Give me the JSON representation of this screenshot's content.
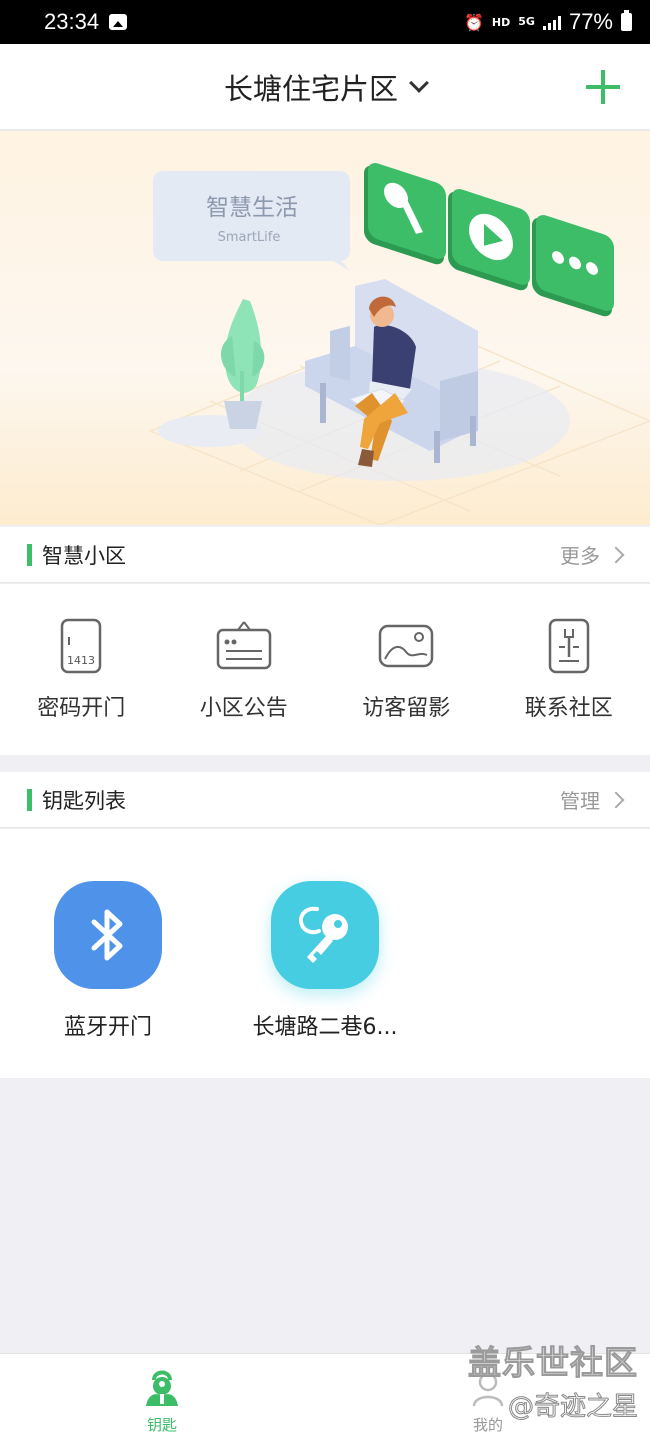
{
  "status_bar": {
    "time": "23:34",
    "network": "HD",
    "network_type": "5G",
    "battery": "77%"
  },
  "header": {
    "title": "长塘住宅片区"
  },
  "banner": {
    "bubble_title": "智慧生活",
    "bubble_subtitle": "SmartLife"
  },
  "smart_section": {
    "title": "智慧小区",
    "more_label": "更多",
    "items": [
      {
        "label": "密码开门",
        "icon": "keypad-icon",
        "icon_text": "1413"
      },
      {
        "label": "小区公告",
        "icon": "notice-board-icon"
      },
      {
        "label": "访客留影",
        "icon": "photo-icon"
      },
      {
        "label": "联系社区",
        "icon": "wrench-document-icon"
      }
    ]
  },
  "keys_section": {
    "title": "钥匙列表",
    "manage_label": "管理",
    "items": [
      {
        "label": "蓝牙开门",
        "icon": "bluetooth-icon",
        "color": "#4e92ea"
      },
      {
        "label": "长塘路二巷6...",
        "icon": "key-icon",
        "color": "#46cde2"
      }
    ]
  },
  "tabbar": {
    "tabs": [
      {
        "label": "钥匙",
        "active": true,
        "color": "#3dbd68"
      },
      {
        "label": "我的",
        "active": false,
        "color": "#999999"
      }
    ]
  },
  "watermark": {
    "line1": "盖乐世社区",
    "line2": "@奇迹之星"
  },
  "colors": {
    "accent": "#3dbd68",
    "background": "#efeff4"
  }
}
